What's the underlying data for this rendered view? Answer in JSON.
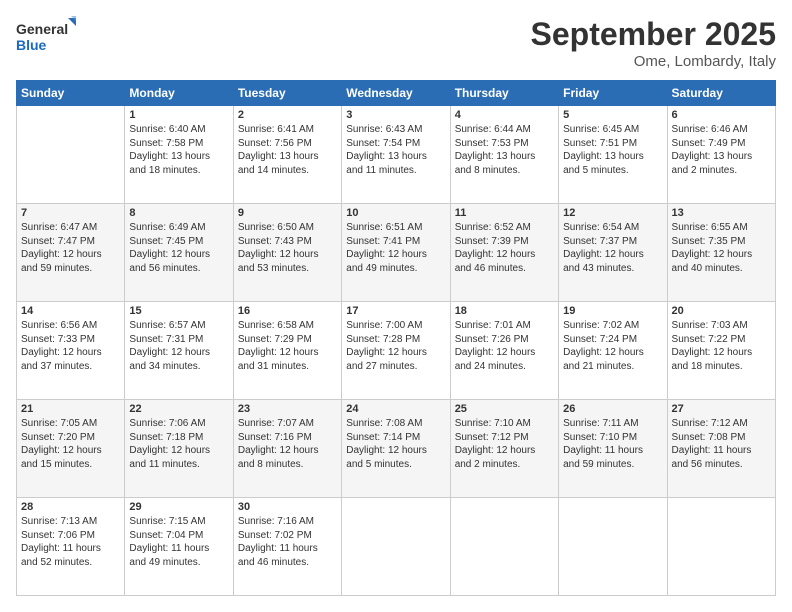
{
  "header": {
    "logo_line1": "General",
    "logo_line2": "Blue",
    "month_title": "September 2025",
    "location": "Ome, Lombardy, Italy"
  },
  "days_of_week": [
    "Sunday",
    "Monday",
    "Tuesday",
    "Wednesday",
    "Thursday",
    "Friday",
    "Saturday"
  ],
  "weeks": [
    [
      {
        "day": "",
        "info": ""
      },
      {
        "day": "1",
        "info": "Sunrise: 6:40 AM\nSunset: 7:58 PM\nDaylight: 13 hours\nand 18 minutes."
      },
      {
        "day": "2",
        "info": "Sunrise: 6:41 AM\nSunset: 7:56 PM\nDaylight: 13 hours\nand 14 minutes."
      },
      {
        "day": "3",
        "info": "Sunrise: 6:43 AM\nSunset: 7:54 PM\nDaylight: 13 hours\nand 11 minutes."
      },
      {
        "day": "4",
        "info": "Sunrise: 6:44 AM\nSunset: 7:53 PM\nDaylight: 13 hours\nand 8 minutes."
      },
      {
        "day": "5",
        "info": "Sunrise: 6:45 AM\nSunset: 7:51 PM\nDaylight: 13 hours\nand 5 minutes."
      },
      {
        "day": "6",
        "info": "Sunrise: 6:46 AM\nSunset: 7:49 PM\nDaylight: 13 hours\nand 2 minutes."
      }
    ],
    [
      {
        "day": "7",
        "info": "Sunrise: 6:47 AM\nSunset: 7:47 PM\nDaylight: 12 hours\nand 59 minutes."
      },
      {
        "day": "8",
        "info": "Sunrise: 6:49 AM\nSunset: 7:45 PM\nDaylight: 12 hours\nand 56 minutes."
      },
      {
        "day": "9",
        "info": "Sunrise: 6:50 AM\nSunset: 7:43 PM\nDaylight: 12 hours\nand 53 minutes."
      },
      {
        "day": "10",
        "info": "Sunrise: 6:51 AM\nSunset: 7:41 PM\nDaylight: 12 hours\nand 49 minutes."
      },
      {
        "day": "11",
        "info": "Sunrise: 6:52 AM\nSunset: 7:39 PM\nDaylight: 12 hours\nand 46 minutes."
      },
      {
        "day": "12",
        "info": "Sunrise: 6:54 AM\nSunset: 7:37 PM\nDaylight: 12 hours\nand 43 minutes."
      },
      {
        "day": "13",
        "info": "Sunrise: 6:55 AM\nSunset: 7:35 PM\nDaylight: 12 hours\nand 40 minutes."
      }
    ],
    [
      {
        "day": "14",
        "info": "Sunrise: 6:56 AM\nSunset: 7:33 PM\nDaylight: 12 hours\nand 37 minutes."
      },
      {
        "day": "15",
        "info": "Sunrise: 6:57 AM\nSunset: 7:31 PM\nDaylight: 12 hours\nand 34 minutes."
      },
      {
        "day": "16",
        "info": "Sunrise: 6:58 AM\nSunset: 7:29 PM\nDaylight: 12 hours\nand 31 minutes."
      },
      {
        "day": "17",
        "info": "Sunrise: 7:00 AM\nSunset: 7:28 PM\nDaylight: 12 hours\nand 27 minutes."
      },
      {
        "day": "18",
        "info": "Sunrise: 7:01 AM\nSunset: 7:26 PM\nDaylight: 12 hours\nand 24 minutes."
      },
      {
        "day": "19",
        "info": "Sunrise: 7:02 AM\nSunset: 7:24 PM\nDaylight: 12 hours\nand 21 minutes."
      },
      {
        "day": "20",
        "info": "Sunrise: 7:03 AM\nSunset: 7:22 PM\nDaylight: 12 hours\nand 18 minutes."
      }
    ],
    [
      {
        "day": "21",
        "info": "Sunrise: 7:05 AM\nSunset: 7:20 PM\nDaylight: 12 hours\nand 15 minutes."
      },
      {
        "day": "22",
        "info": "Sunrise: 7:06 AM\nSunset: 7:18 PM\nDaylight: 12 hours\nand 11 minutes."
      },
      {
        "day": "23",
        "info": "Sunrise: 7:07 AM\nSunset: 7:16 PM\nDaylight: 12 hours\nand 8 minutes."
      },
      {
        "day": "24",
        "info": "Sunrise: 7:08 AM\nSunset: 7:14 PM\nDaylight: 12 hours\nand 5 minutes."
      },
      {
        "day": "25",
        "info": "Sunrise: 7:10 AM\nSunset: 7:12 PM\nDaylight: 12 hours\nand 2 minutes."
      },
      {
        "day": "26",
        "info": "Sunrise: 7:11 AM\nSunset: 7:10 PM\nDaylight: 11 hours\nand 59 minutes."
      },
      {
        "day": "27",
        "info": "Sunrise: 7:12 AM\nSunset: 7:08 PM\nDaylight: 11 hours\nand 56 minutes."
      }
    ],
    [
      {
        "day": "28",
        "info": "Sunrise: 7:13 AM\nSunset: 7:06 PM\nDaylight: 11 hours\nand 52 minutes."
      },
      {
        "day": "29",
        "info": "Sunrise: 7:15 AM\nSunset: 7:04 PM\nDaylight: 11 hours\nand 49 minutes."
      },
      {
        "day": "30",
        "info": "Sunrise: 7:16 AM\nSunset: 7:02 PM\nDaylight: 11 hours\nand 46 minutes."
      },
      {
        "day": "",
        "info": ""
      },
      {
        "day": "",
        "info": ""
      },
      {
        "day": "",
        "info": ""
      },
      {
        "day": "",
        "info": ""
      }
    ]
  ]
}
